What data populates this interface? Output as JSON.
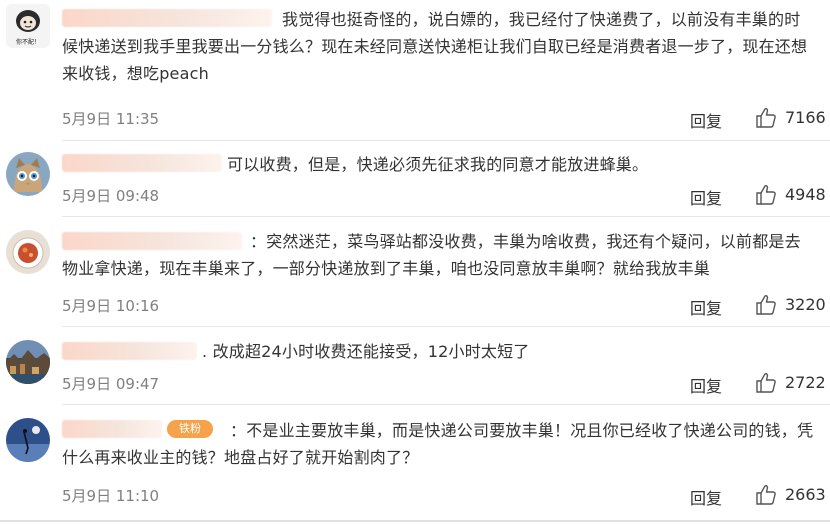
{
  "comments": [
    {
      "avatar_caption": "你不配！",
      "text": "我觉得也挺奇怪的，说白嫖的，我已经付了快递费了，以前没有丰巢的时候快递送到我手里我要出一分钱么？现在未经同意送快递柜让我们自取已经是消费者退一步了，现在还想来收钱，想吃peach",
      "date": "5月9日 11:35",
      "reply": "回复",
      "likes": "7166"
    },
    {
      "text": "可以收费，但是，快递必须先征求我的同意才能放进蜂巢。",
      "date": "5月9日 09:48",
      "reply": "回复",
      "likes": "4948"
    },
    {
      "text": "：突然迷茫，菜鸟驿站都没收费，丰巢为啥收费，我还有个疑问，以前都是去物业拿快递，现在丰巢来了，一部分快递放到了丰巢，咱也没同意放丰巢啊？就给我放丰巢",
      "date": "5月9日 10:16",
      "reply": "回复",
      "likes": "3220"
    },
    {
      "text": ". 改成超24小时收费还能接受，12小时太短了",
      "date": "5月9日 09:47",
      "reply": "回复",
      "likes": "2722"
    },
    {
      "badge": "铁粉",
      "text": "：不是业主要放丰巢，而是快递公司要放丰巢！况且你已经收了快递公司的钱，凭什么再来收业主的钱？地盘占好了就开始割肉了？",
      "date": "5月9日 11:10",
      "reply": "回复",
      "likes": "2663"
    }
  ],
  "colors": {
    "text": "#333333",
    "meta": "#808080",
    "divider": "#e8e8e8",
    "badge": "#f6a24a",
    "name_blur": "#fbd7c9"
  },
  "icons": {
    "like": "thumb-up-icon"
  }
}
